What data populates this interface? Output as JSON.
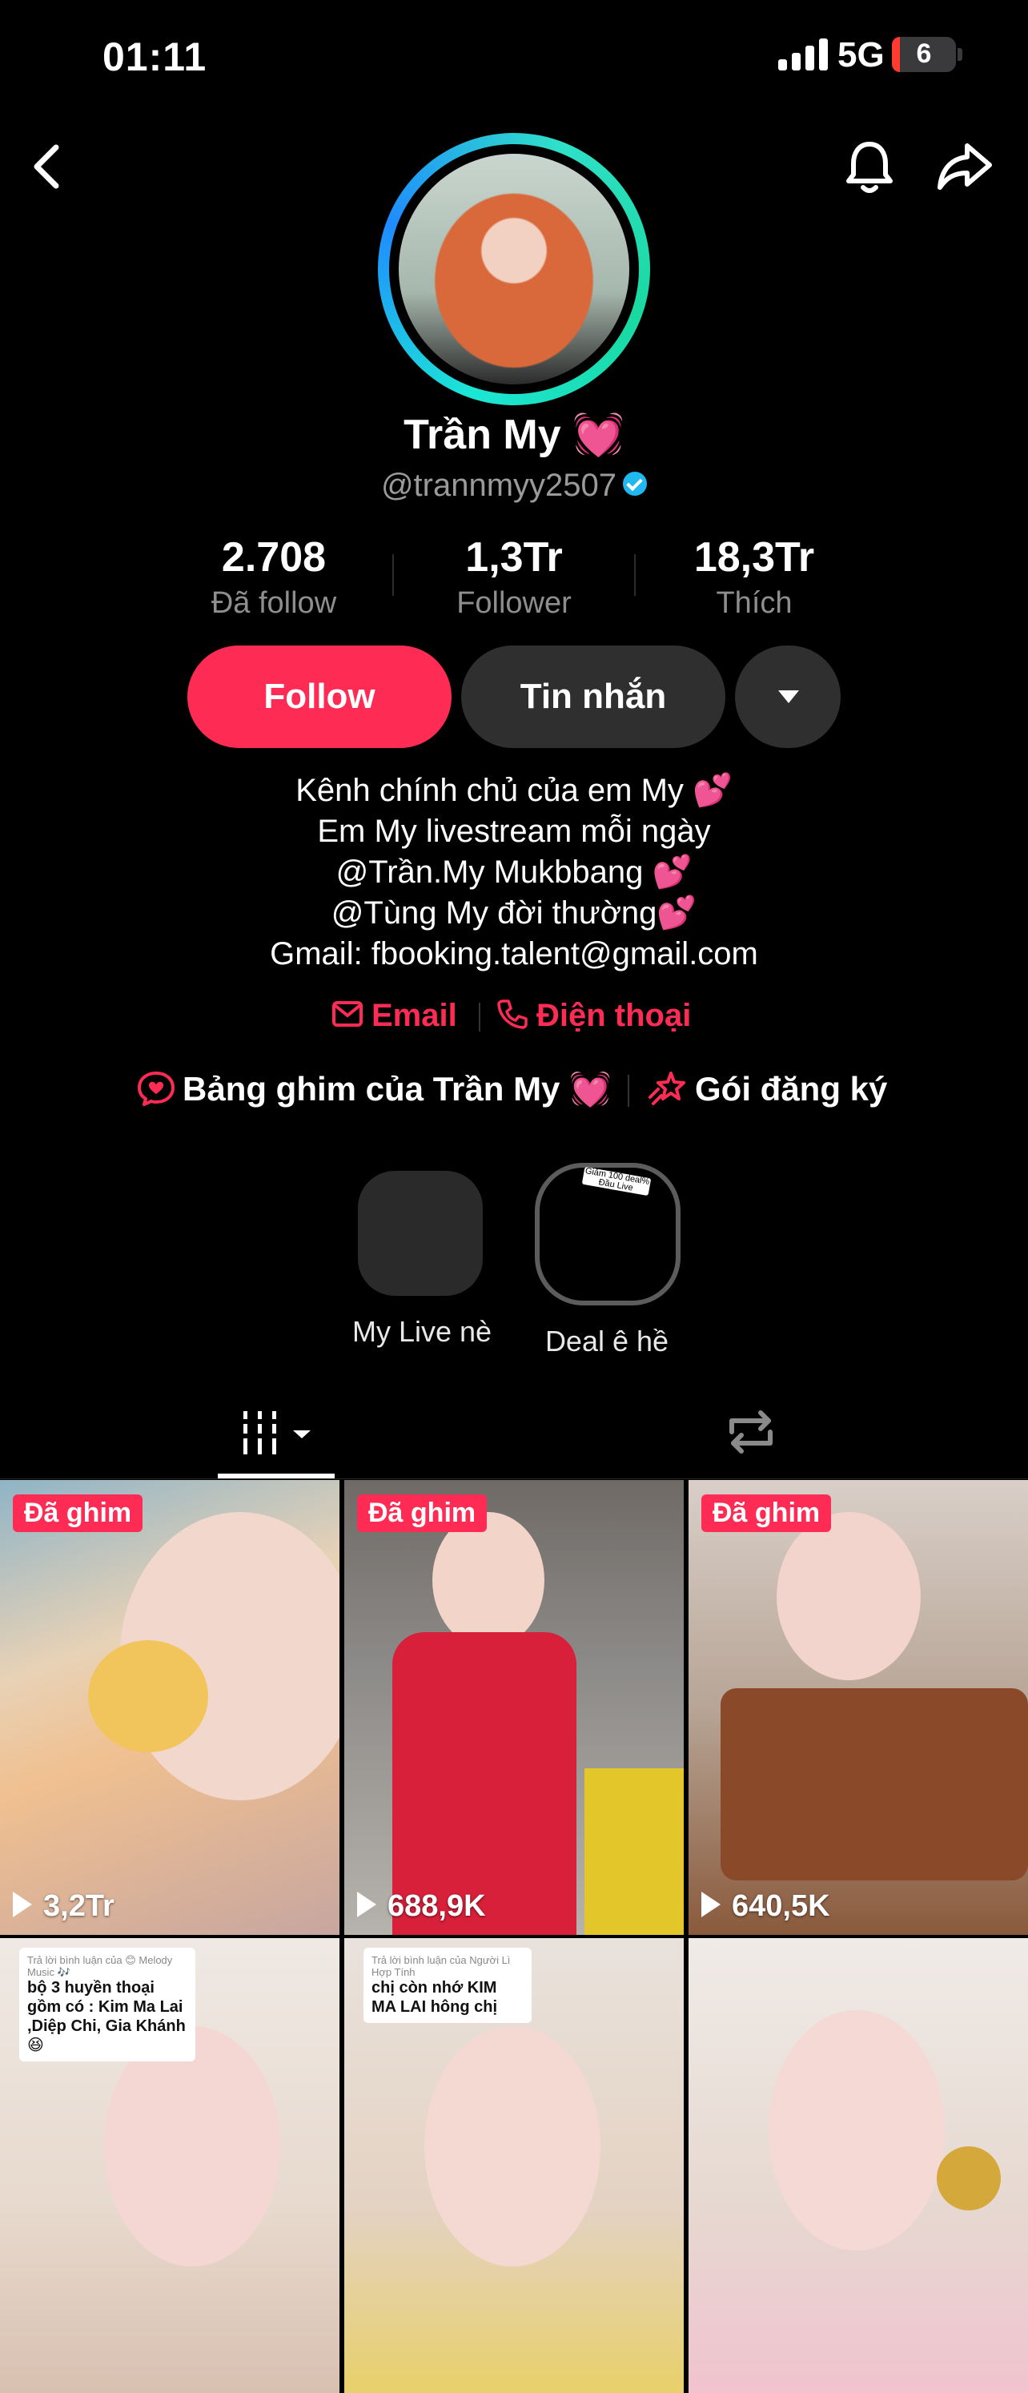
{
  "status_bar": {
    "time": "01:11",
    "network": "5G",
    "battery": "6"
  },
  "profile": {
    "name": "Trần My 💓",
    "handle": "@trannmyy2507",
    "stats": [
      {
        "value": "2.708",
        "label": "Đã follow"
      },
      {
        "value": "1,3Tr",
        "label": "Follower"
      },
      {
        "value": "18,3Tr",
        "label": "Thích"
      }
    ]
  },
  "actions": {
    "follow": "Follow",
    "message": "Tin nhắn"
  },
  "bio": {
    "line1": "Kênh chính chủ của em My 💕",
    "line2": "Em My livestream mỗi ngày",
    "line3": "@Trần.My Mukbbang 💕",
    "line4": "@Tùng My đời thường💕",
    "line5": "Gmail: fbooking.talent@gmail.com"
  },
  "contact": {
    "email": "Email",
    "phone": "Điện thoại"
  },
  "pins": {
    "board": "Bảng ghim của Trần My 💓",
    "subscribe": "Gói đăng ký"
  },
  "highlights": [
    {
      "label": "My Live nè"
    },
    {
      "label": "Deal ê hề",
      "sticker": "Giảm 100 deal% Đầu Live"
    }
  ],
  "videos": [
    {
      "pinned": "Đã ghim",
      "views": "3,2Tr"
    },
    {
      "pinned": "Đã ghim",
      "views": "688,9K"
    },
    {
      "pinned": "Đã ghim",
      "views": "640,5K"
    },
    {
      "reply_meta": "Trả lời bình luận của 😊 Melody Music 🎶",
      "reply_text": "bộ 3 huyền thoại gồm có : Kim Ma Lai ,Diệp Chi, Gia Khánh😆"
    },
    {
      "reply_meta": "Trả lời bình luận của Người Lì Hợp Tính",
      "reply_text": "chị còn nhớ KIM MA LAI hông chị"
    },
    {}
  ],
  "colors": {
    "accent": "#fe2c55",
    "ring_start": "#1f8bff",
    "ring_end": "#19d9a0"
  }
}
